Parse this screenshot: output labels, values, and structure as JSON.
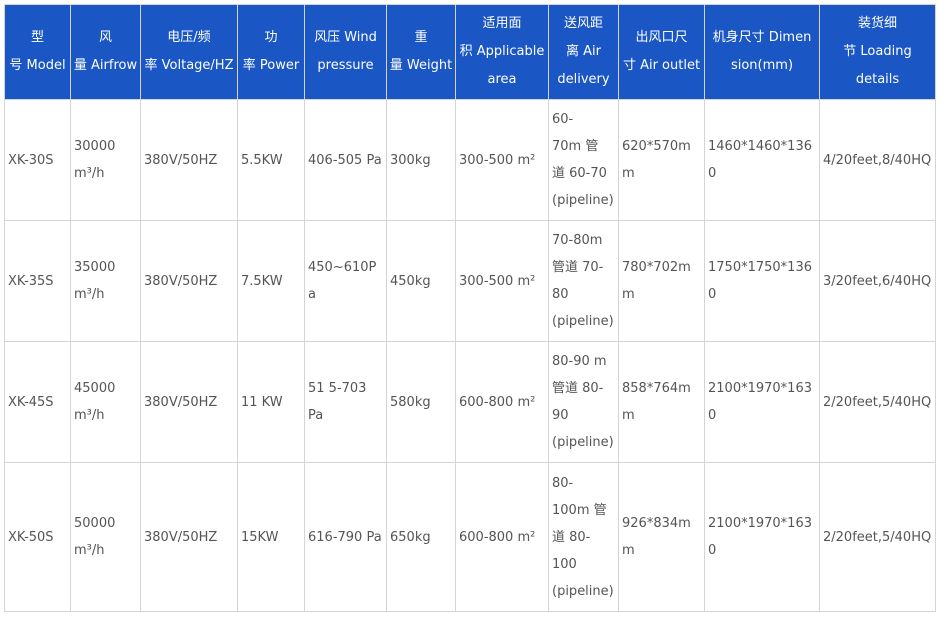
{
  "headers": [
    [
      "型",
      "号 Model"
    ],
    [
      "风",
      "量 Airfrow"
    ],
    [
      "电压/频",
      "率 Voltage/HZ"
    ],
    [
      "功",
      "率 Power"
    ],
    [
      "风压 Wind",
      "pressure"
    ],
    [
      "重",
      "量 Weight"
    ],
    [
      "适用面",
      "积 Applicable",
      "area"
    ],
    [
      "送风距",
      "离 Air",
      "delivery"
    ],
    [
      "出风口尺",
      "寸 Air outlet"
    ],
    [
      "机身尺寸 Dimen",
      "sion(mm)"
    ],
    [
      "装货细",
      "节 Loading",
      "details"
    ]
  ],
  "rows": [
    {
      "model": "XK-30S",
      "airflow": [
        "30000",
        "m³/h"
      ],
      "voltage": "380V/50HZ",
      "power": "5.5KW",
      "pressure": [
        "406-505 Pa"
      ],
      "weight": "300kg",
      "area": "300-500 m²",
      "delivery": [
        "60-",
        "70m 管",
        "道 60-70",
        "(pipeline)"
      ],
      "outlet": "620*570mm",
      "dimension": "1460*1460*1360",
      "loading": "4/20feet,8/40HQ"
    },
    {
      "model": "XK-35S",
      "airflow": [
        "35000",
        "m³/h"
      ],
      "voltage": "380V/50HZ",
      "power": "7.5KW",
      "pressure": [
        "450~610Pa"
      ],
      "weight": "450kg",
      "area": "300-500 m²",
      "delivery": [
        "70-80m",
        "管道 70-",
        "80",
        "(pipeline)"
      ],
      "outlet": "780*702mm",
      "dimension": "1750*1750*1360",
      "loading": "3/20feet,6/40HQ"
    },
    {
      "model": "XK-45S",
      "airflow": [
        "45000",
        "m³/h"
      ],
      "voltage": "380V/50HZ",
      "power": "11 KW",
      "pressure": [
        "51 5-703",
        "Pa"
      ],
      "weight": "580kg",
      "area": "600-800 m²",
      "delivery": [
        "80-90 m",
        "管道 80-",
        "90",
        "(pipeline)"
      ],
      "outlet": "858*764mm",
      "dimension": "2100*1970*1630",
      "loading": "2/20feet,5/40HQ"
    },
    {
      "model": "XK-50S",
      "airflow": [
        "50000",
        "m³/h"
      ],
      "voltage": "380V/50HZ",
      "power": "15KW",
      "pressure": [
        "616-790 Pa"
      ],
      "weight": "650kg",
      "area": "600-800 m²",
      "delivery": [
        "80-",
        "100m 管",
        "道 80-",
        "100",
        "(pipeline)"
      ],
      "outlet": "926*834mm",
      "dimension": "2100*1970*1630",
      "loading": "2/20feet,5/40HQ"
    }
  ]
}
